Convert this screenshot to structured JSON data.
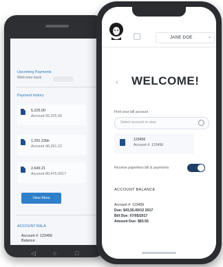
{
  "android_app": {
    "greeting_line1": "Upcoming Payments",
    "greeting_line2": "Welcome back",
    "section_title": "Payment history",
    "payments": [
      {
        "amount": "5,225.00",
        "account": "Account 55,225.00"
      },
      {
        "amount": "1,291.22bk",
        "account": "Account 46,291.22"
      },
      {
        "amount": "2,649.21",
        "account": "Account 80,475.2017"
      }
    ],
    "button_label": "View More",
    "account_section_title": "ACCOUNT BALA",
    "account_line": "Account #: 123456",
    "account_line2": "Balance:"
  },
  "iphone_app": {
    "user_name": "JANE DOE",
    "welcome_title": "WELCOME!",
    "search_label": "Find your bill account",
    "search_placeholder": "Select account to view",
    "card": {
      "title": "123456",
      "subtitle": "Account #: 123456"
    },
    "toggle_label": "Receive paperless bill & payments",
    "section_title": "ACCOUNT BALANCE",
    "details": [
      {
        "text": "Account #: 123456",
        "bold": false
      },
      {
        "text": "Due: $43,55.00/12 2017",
        "bold": true
      },
      {
        "text": "Bill Due: 07/05/2017",
        "bold": true
      },
      {
        "text": "Amount Due: $83.55",
        "bold": true
      }
    ],
    "toggle_on": true
  }
}
